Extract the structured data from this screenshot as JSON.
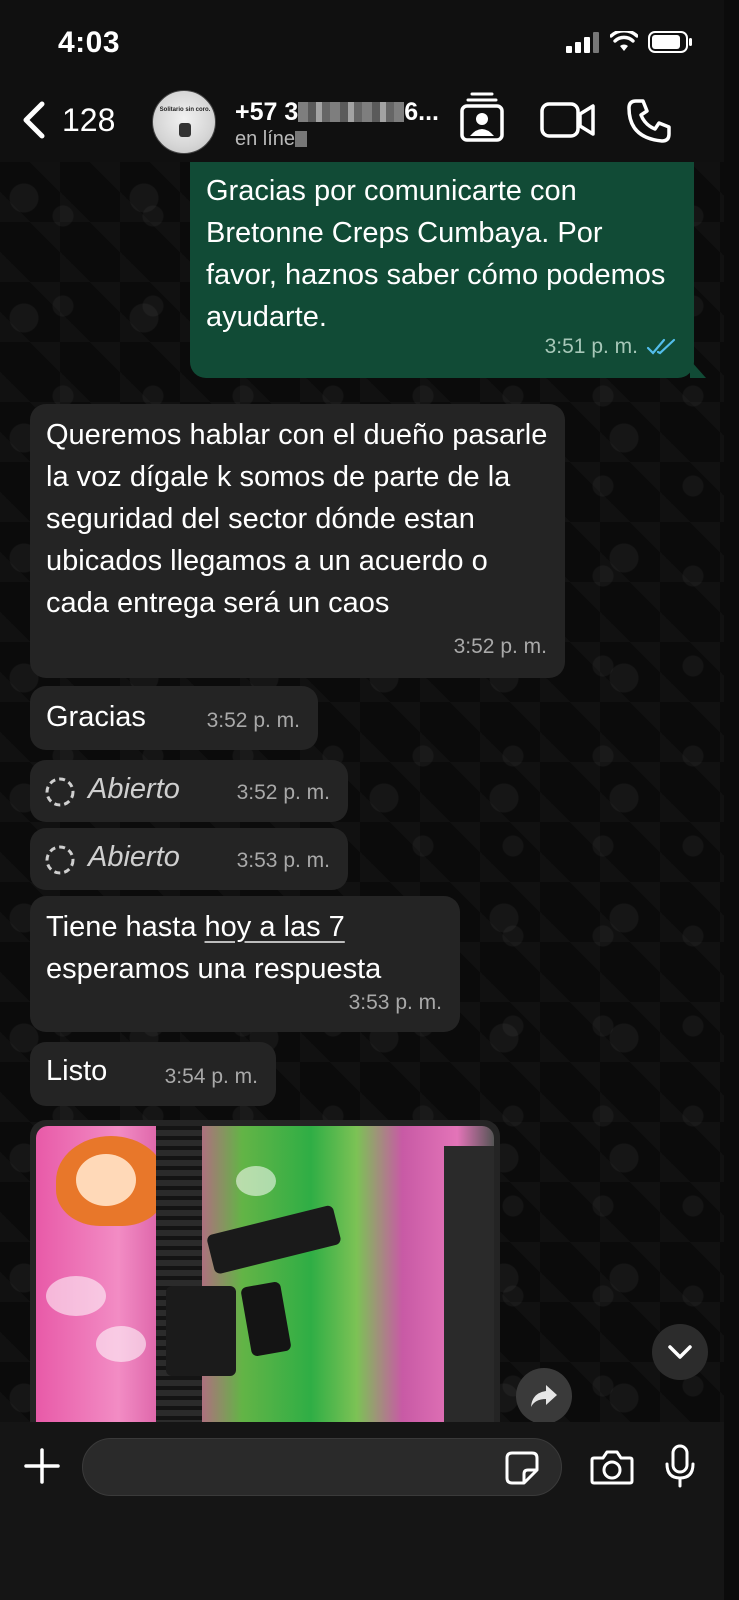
{
  "status_bar": {
    "time": "4:03"
  },
  "header": {
    "back_count": "128",
    "contact_name_prefix": "+57 3",
    "contact_name_suffix": "6...",
    "contact_status": "en líne",
    "avatar_text": "Solitario sin coro."
  },
  "messages": [
    {
      "id": "m1",
      "direction": "out",
      "text": "Gracias por comunicarte con Bretonne Creps Cumbaya. Por favor, haznos saber cómo podemos ayudarte.",
      "time": "3:51 p. m.",
      "read": true
    },
    {
      "id": "m2",
      "direction": "in",
      "text": "Queremos hablar con el dueño pasarle la voz dígale k somos de parte de la seguridad del sector dónde estan ubicados llegamos a un acuerdo o cada entrega será un caos",
      "time": "3:52 p. m."
    },
    {
      "id": "m3",
      "direction": "in",
      "text": "Gracias",
      "time": "3:52 p. m."
    },
    {
      "id": "m4",
      "direction": "in",
      "text": "Abierto",
      "time": "3:52 p. m.",
      "view_once": true
    },
    {
      "id": "m5",
      "direction": "in",
      "text": "Abierto",
      "time": "3:53 p. m.",
      "view_once": true
    },
    {
      "id": "m6",
      "direction": "in",
      "text_before": "Tiene hasta ",
      "text_link": "hoy a las 7",
      "text_after": "esperamos una respuesta",
      "time": "3:53 p. m."
    },
    {
      "id": "m7",
      "direction": "in",
      "text": "Listo",
      "time": "3:54 p. m."
    }
  ],
  "colors": {
    "outgoing": "#114b36",
    "incoming": "#242424",
    "read_ticks": "#53bdeb"
  },
  "icons": [
    "back-chevron-icon",
    "contact-card-icon",
    "video-call-icon",
    "phone-icon",
    "forward-icon",
    "chevron-down-icon",
    "plus-icon",
    "sticker-icon",
    "camera-icon",
    "microphone-icon"
  ]
}
